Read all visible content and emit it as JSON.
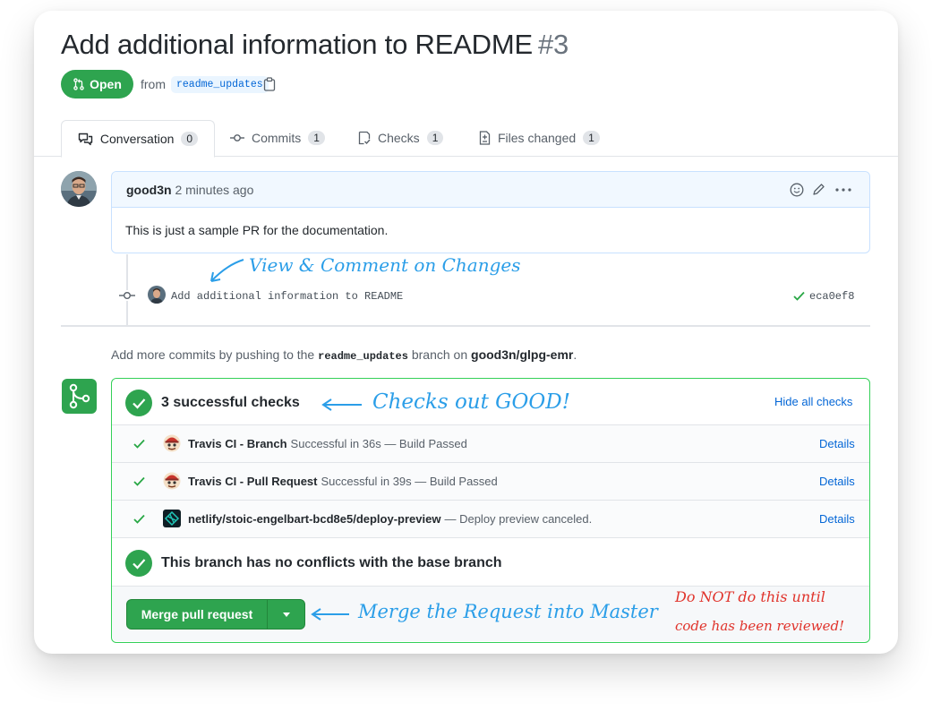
{
  "pr": {
    "title": "Add additional information to README",
    "number": "#3",
    "state": "Open",
    "from_label": "from",
    "branch": "readme_updates"
  },
  "tabs": [
    {
      "label": "Conversation",
      "count": "0"
    },
    {
      "label": "Commits",
      "count": "1"
    },
    {
      "label": "Checks",
      "count": "1"
    },
    {
      "label": "Files changed",
      "count": "1"
    }
  ],
  "comment": {
    "author": "good3n",
    "time": "2 minutes ago",
    "body": "This is just a sample PR for the documentation."
  },
  "commit": {
    "message": "Add additional information to README",
    "sha": "eca0ef8"
  },
  "push_note": {
    "prefix": "Add more commits by pushing to the",
    "branch": "readme_updates",
    "middle": "branch on",
    "repo": "good3n/glpg-emr",
    "suffix": "."
  },
  "checks": {
    "summary": "3 successful checks",
    "toggle_label": "Hide all checks",
    "items": [
      {
        "name": "Travis CI - Branch",
        "desc": "Successful in 36s — Build Passed",
        "link": "Details"
      },
      {
        "name": "Travis CI - Pull Request",
        "desc": "Successful in 39s — Build Passed",
        "link": "Details"
      },
      {
        "name": "netlify/stoic-engelbart-bcd8e5/deploy-preview",
        "desc": "— Deploy preview canceled.",
        "link": "Details"
      }
    ]
  },
  "conflicts": {
    "text": "This branch has no conflicts with the base branch"
  },
  "merge": {
    "button_label": "Merge pull request"
  },
  "annotations": {
    "view_comment": "View & Comment on Changes",
    "checks_good": "Checks out GOOD!",
    "merge_note": "Merge the Request into Master",
    "warning_line1": "Do NOT do this until",
    "warning_line2": "code has been reviewed!"
  },
  "colors": {
    "accent_green": "#2ea44f",
    "link_blue": "#0366d6",
    "annotation_blue": "#2b9ee8",
    "annotation_red": "#e0332b"
  },
  "icons": {
    "state": "git-pull-request-icon",
    "copy": "clipboard-icon",
    "tab_conversation": "comment-discussion-icon",
    "tab_commits": "git-commit-icon",
    "tab_checks": "checklist-icon",
    "tab_files": "file-diff-icon",
    "comment_actions": [
      "smiley-icon",
      "pencil-icon",
      "kebab-icon"
    ],
    "mergebox": "git-merge-icon"
  }
}
